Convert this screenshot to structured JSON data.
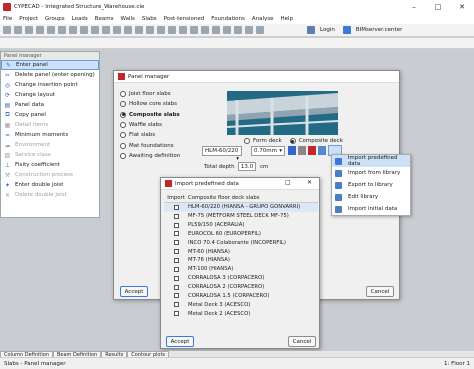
{
  "window": {
    "title": "CYPECAD - Integrated Structure_Warehouse.cie",
    "min": "–",
    "max": "□",
    "close": "✕"
  },
  "menu": [
    "File",
    "Project",
    "Groups",
    "Loads",
    "Beams",
    "Walls",
    "Slabs",
    "Post-tensioned",
    "Foundations",
    "Analyse",
    "Help"
  ],
  "toolbar": {
    "login": "Login",
    "server": "BIMserver.center"
  },
  "panel_manager": {
    "header": "Panel manager",
    "items": [
      {
        "label": "Enter panel",
        "state": "selected"
      },
      {
        "label": "Delete panel (enter opening)",
        "state": "normal"
      },
      {
        "label": "Change insertion point",
        "state": "normal"
      },
      {
        "label": "Change layout",
        "state": "normal"
      },
      {
        "label": "Panel data",
        "state": "normal"
      },
      {
        "label": "Copy panel",
        "state": "normal"
      },
      {
        "label": "Detail items",
        "state": "disabled"
      },
      {
        "label": "Minimum moments",
        "state": "normal"
      },
      {
        "label": "Environment",
        "state": "disabled"
      },
      {
        "label": "Service class",
        "state": "disabled"
      },
      {
        "label": "Fixity coefficient",
        "state": "normal"
      },
      {
        "label": "Construction process",
        "state": "disabled"
      },
      {
        "label": "Enter double joist",
        "state": "normal"
      },
      {
        "label": "Delete double joist",
        "state": "disabled"
      }
    ]
  },
  "dialog": {
    "title": "Panel manager",
    "slab_types": [
      {
        "label": "Joist floor slabs",
        "checked": false
      },
      {
        "label": "Hollow core slabs",
        "checked": false
      },
      {
        "label": "Composite slabs",
        "checked": true
      },
      {
        "label": "Waffle slabs",
        "checked": false
      },
      {
        "label": "Flat slabs",
        "checked": false
      },
      {
        "label": "Mat foundations",
        "checked": false
      },
      {
        "label": "Awaiting definition",
        "checked": false
      }
    ],
    "form_deck": "Form deck",
    "composite_deck": "Composite deck",
    "profile": "HLM-60/220",
    "thickness": "0.70mm",
    "total_depth_label": "Total depth",
    "total_depth_value": "13.0",
    "total_depth_unit": "cm",
    "accept": "Accept",
    "cancel": "Cancel"
  },
  "context_menu": [
    {
      "label": "Import predefined data",
      "selected": true
    },
    {
      "label": "Import from library",
      "selected": false
    },
    {
      "label": "Export to library",
      "selected": false
    },
    {
      "label": "Edit library",
      "selected": false
    },
    {
      "label": "Import initial data",
      "selected": false
    }
  ],
  "import_dialog": {
    "title": "Import predefined data",
    "col_import": "Import",
    "col_name": "Composite floor deck slabs",
    "rows": [
      "HLM-60/220 (HIANSA - GRUPO GONVARRI)",
      "MF-75 (METFORM STEEL DECK MF-75)",
      "PL59/150 (ACERALIA)",
      "EUROCOL 60 (EUROPERFIL)",
      "INCO 70.4 Colaborante (INCOPERFIL)",
      "MT-60 (HIANSA)",
      "MT-76 (HIANSA)",
      "MT-100 (HIANSA)",
      "CORRALOSA 3 (CORPACERO)",
      "CORRALOSA 2 (CORPACERO)",
      "CORRALOSA 1.5 (CORPACERO)",
      "Metal Deck 3 (ACESCO)",
      "Metal Deck 2 (ACESCO)"
    ],
    "selected_row": 0,
    "accept": "Accept",
    "cancel": "Cancel"
  },
  "bottom_tabs": [
    "Column Definition",
    "Beam Definition",
    "Results",
    "Contour plots"
  ],
  "status": {
    "left": "Slabs - Panel manager",
    "right": "1: Floor 1"
  }
}
